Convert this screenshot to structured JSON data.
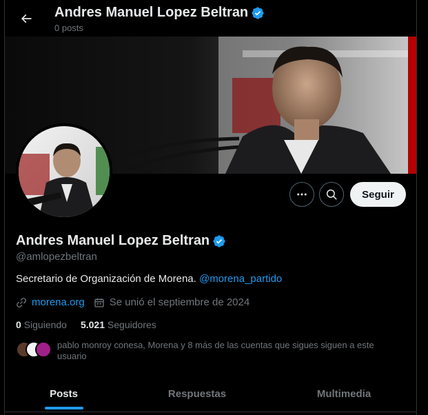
{
  "header": {
    "name": "Andres Manuel Lopez Beltran",
    "posts_count": "0 posts"
  },
  "actions": {
    "follow_label": "Seguir"
  },
  "profile": {
    "name": "Andres Manuel Lopez Beltran",
    "handle": "@amlopezbeltran",
    "bio_text": "Secretario de Organización de Morena. ",
    "bio_mention": "@morena_partido",
    "website": "morena.org",
    "joined": "Se unió el septiembre de 2024",
    "following_count": "0",
    "following_label": "Siguiendo",
    "followers_count": "5.021",
    "followers_label": "Seguidores",
    "followers_you_know": "pablo monroy conesa, Morena y 8 más de las cuentas que sigues siguen a este usuario"
  },
  "tabs": [
    {
      "label": "Posts",
      "active": true
    },
    {
      "label": "Respuestas",
      "active": false
    },
    {
      "label": "Multimedia",
      "active": false
    }
  ],
  "colors": {
    "accent": "#1d9bf0",
    "background": "#000000",
    "muted": "#71767b",
    "text": "#e7e9ea"
  },
  "icons": [
    "back-arrow-icon",
    "verified-badge-icon",
    "more-icon",
    "search-icon",
    "link-icon",
    "calendar-icon"
  ]
}
